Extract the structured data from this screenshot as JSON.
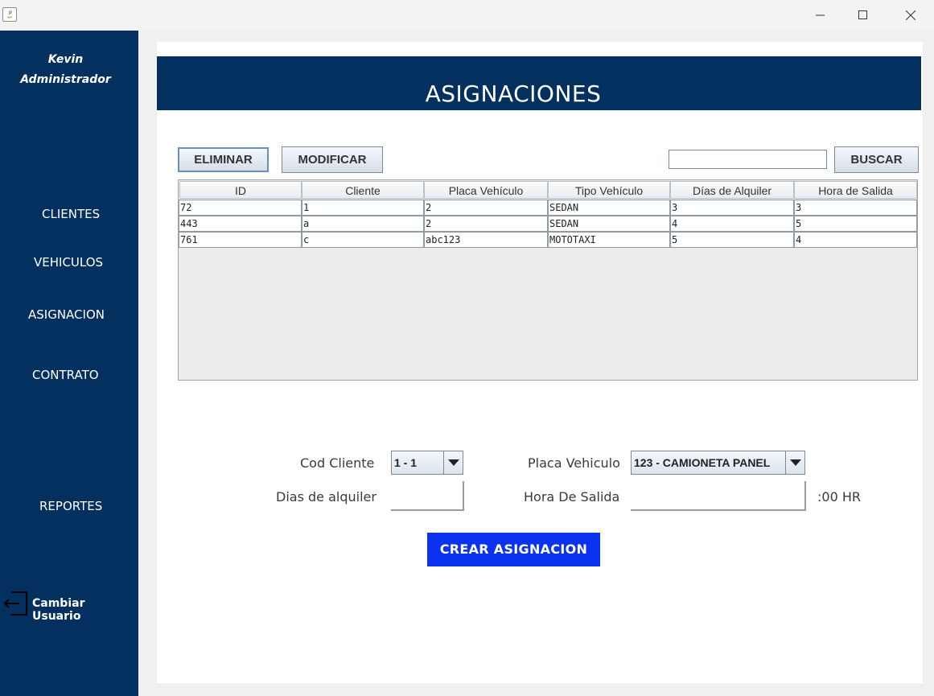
{
  "window": {
    "app_icon": "java-icon",
    "controls": [
      "minimize-icon",
      "maximize-icon",
      "close-icon"
    ]
  },
  "sidebar": {
    "user_name": "Kevin",
    "user_role": "Administrador",
    "nav": {
      "clientes": "CLIENTES",
      "vehiculos": "VEHICULOS",
      "asignacion": "ASIGNACION",
      "contrato": "CONTRATO",
      "reportes": "REPORTES"
    },
    "logout_label": "Cambiar Usuario",
    "logout_icon": "logout-icon"
  },
  "header": {
    "title": "ASIGNACIONES"
  },
  "toolbar": {
    "delete_label": "ELIMINAR",
    "modify_label": "MODIFICAR",
    "search_value": "",
    "search_label": "BUSCAR"
  },
  "table": {
    "columns": [
      "ID",
      "Cliente",
      "Placa Vehículo",
      "Tipo Vehículo",
      "Días de Alquiler",
      "Hora de Salida"
    ],
    "rows": [
      [
        "72",
        "1",
        "2",
        "SEDAN",
        "3",
        "3"
      ],
      [
        "443",
        "a",
        "2",
        "SEDAN",
        "4",
        "5"
      ],
      [
        "761",
        "c",
        "abc123",
        "MOTOTAXI",
        "5",
        "4"
      ]
    ]
  },
  "form": {
    "cod_cliente_label": "Cod Cliente",
    "cod_cliente_value": "1 - 1",
    "placa_label": "Placa Vehiculo",
    "placa_value": "123 - CAMIONETA PANEL",
    "dias_label": "Dias de alquiler",
    "dias_value": "",
    "hora_label": "Hora De Salida",
    "hora_value": "",
    "hora_suffix": ":00 HR",
    "create_label": "CREAR ASIGNACION"
  },
  "colors": {
    "sidebar": "#03305f",
    "header": "#03305f",
    "create_button": "#0a32f0",
    "panel": "#ffffff"
  }
}
